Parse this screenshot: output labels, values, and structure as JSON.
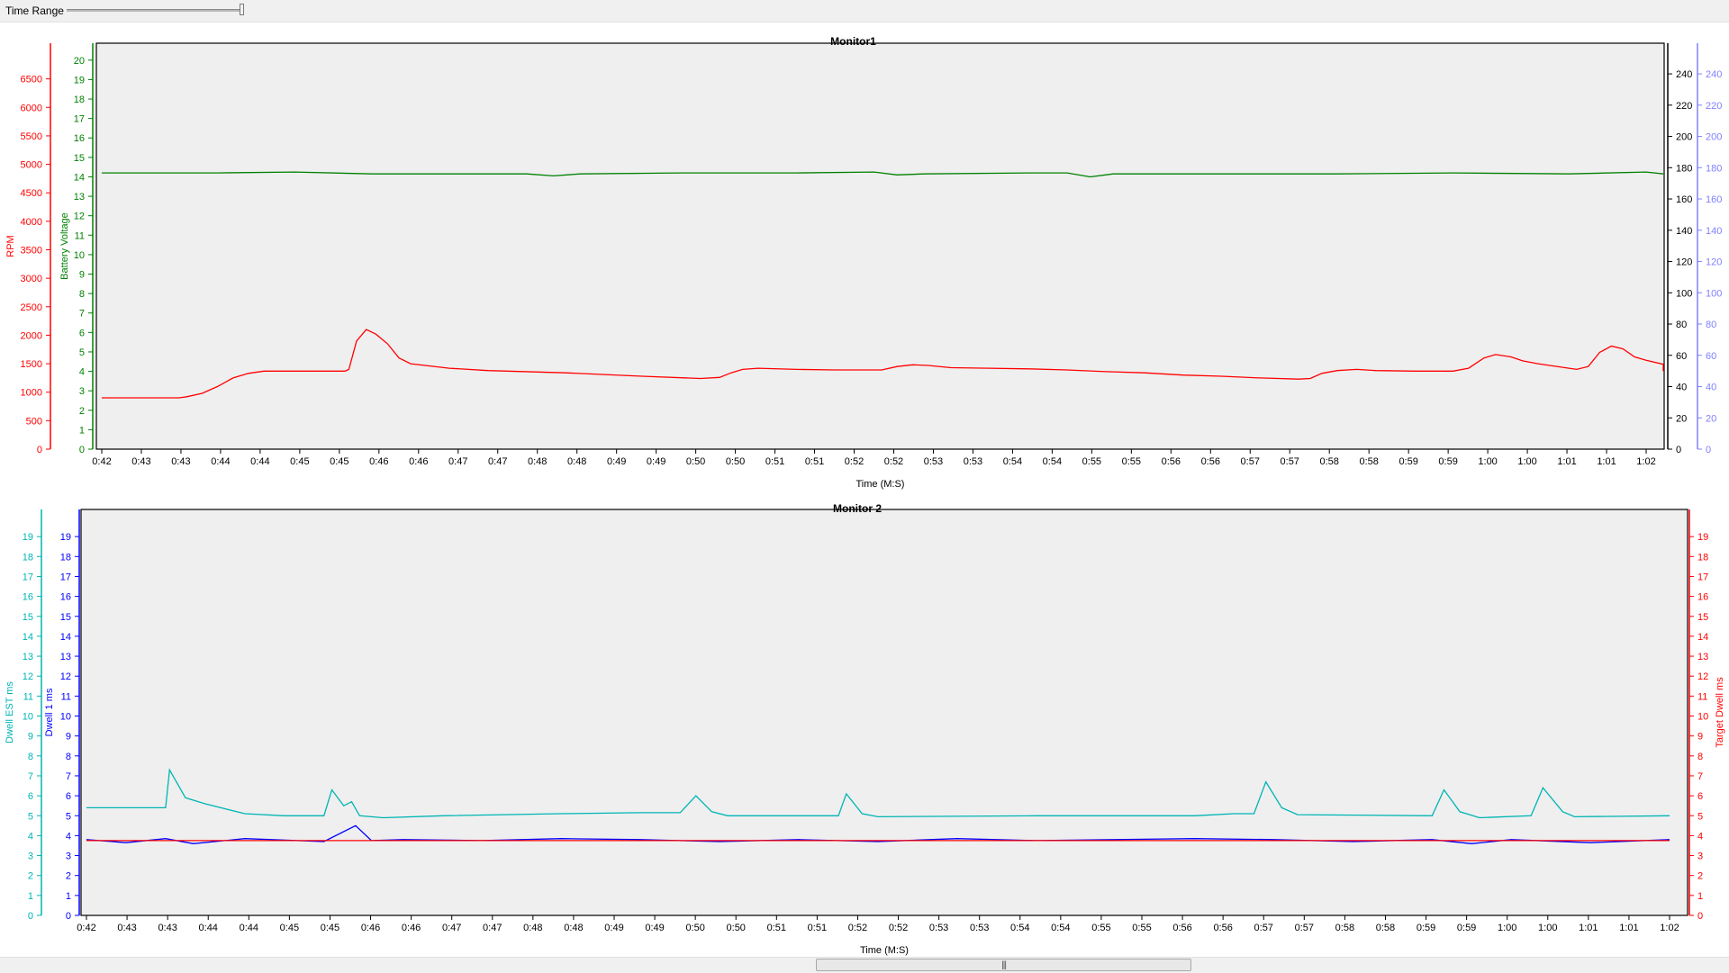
{
  "toolbar": {
    "time_range_label": "Time Range",
    "slider_value": 1.0
  },
  "scrollbar": {
    "thumb_start": 0.472,
    "thumb_end": 0.689
  },
  "colors": {
    "plot_background": "#efefef",
    "red": "#ff0000",
    "green": "#008000",
    "cyan": "#00b4b4",
    "blue": "#0000ff",
    "light_blue": "#8080ff"
  },
  "chart_data": [
    {
      "type": "line",
      "title": "Monitor1",
      "xlabel": "Time (M:S)",
      "x_tick_labels": [
        "0:42",
        "0:43",
        "0:43",
        "0:44",
        "0:44",
        "0:45",
        "0:45",
        "0:46",
        "0:46",
        "0:47",
        "0:47",
        "0:48",
        "0:48",
        "0:49",
        "0:49",
        "0:50",
        "0:50",
        "0:51",
        "0:51",
        "0:52",
        "0:52",
        "0:53",
        "0:53",
        "0:54",
        "0:54",
        "0:55",
        "0:55",
        "0:56",
        "0:56",
        "0:57",
        "0:57",
        "0:58",
        "0:58",
        "0:59",
        "0:59",
        "1:00",
        "1:00",
        "1:01",
        "1:01",
        "1:02"
      ],
      "x_range": [
        0,
        40
      ],
      "grid": false,
      "axes": [
        {
          "id": "rpm",
          "side": "left",
          "label": "RPM",
          "color": "#ff0000",
          "range": [
            0,
            7000
          ],
          "ticks": [
            0,
            500,
            1000,
            1500,
            2000,
            2500,
            3000,
            3500,
            4000,
            4500,
            5000,
            5500,
            6000,
            6500
          ]
        },
        {
          "id": "volt",
          "side": "left",
          "label": "Battery Voltage",
          "color": "#008000",
          "range": [
            0,
            20.5
          ],
          "ticks": [
            0,
            1,
            2,
            3,
            4,
            5,
            6,
            7,
            8,
            9,
            10,
            11,
            12,
            13,
            14,
            15,
            16,
            17,
            18,
            19,
            20
          ]
        },
        {
          "id": "r1",
          "side": "right",
          "label": "",
          "color": "#000000",
          "range": [
            0,
            255
          ],
          "ticks": [
            0,
            20,
            40,
            60,
            80,
            100,
            120,
            140,
            160,
            180,
            200,
            220,
            240
          ]
        },
        {
          "id": "r2",
          "side": "right",
          "label": "",
          "color": "#8080ff",
          "range": [
            0,
            255
          ],
          "ticks": [
            0,
            20,
            40,
            60,
            80,
            100,
            120,
            140,
            160,
            180,
            200,
            220,
            240
          ]
        }
      ],
      "series": [
        {
          "name": "RPM",
          "axis": "rpm",
          "color": "#ff0000",
          "points": [
            [
              0,
              900
            ],
            [
              2,
              900
            ],
            [
              2.2,
              920
            ],
            [
              2.6,
              980
            ],
            [
              3,
              1100
            ],
            [
              3.4,
              1250
            ],
            [
              3.8,
              1330
            ],
            [
              4.2,
              1370
            ],
            [
              6.3,
              1370
            ],
            [
              6.4,
              1400
            ],
            [
              6.6,
              1900
            ],
            [
              6.85,
              2100
            ],
            [
              7.1,
              2020
            ],
            [
              7.4,
              1850
            ],
            [
              7.7,
              1600
            ],
            [
              8,
              1500
            ],
            [
              9,
              1420
            ],
            [
              10,
              1380
            ],
            [
              12,
              1340
            ],
            [
              14,
              1280
            ],
            [
              15.5,
              1240
            ],
            [
              16,
              1260
            ],
            [
              16.3,
              1340
            ],
            [
              16.6,
              1400
            ],
            [
              17,
              1420
            ],
            [
              18,
              1400
            ],
            [
              19,
              1390
            ],
            [
              20.2,
              1390
            ],
            [
              20.6,
              1450
            ],
            [
              21,
              1480
            ],
            [
              21.4,
              1470
            ],
            [
              22,
              1430
            ],
            [
              23,
              1420
            ],
            [
              24,
              1410
            ],
            [
              25,
              1390
            ],
            [
              26,
              1360
            ],
            [
              27,
              1340
            ],
            [
              28,
              1300
            ],
            [
              29,
              1280
            ],
            [
              30,
              1250
            ],
            [
              31,
              1230
            ],
            [
              31.3,
              1240
            ],
            [
              31.6,
              1330
            ],
            [
              32,
              1380
            ],
            [
              32.5,
              1400
            ],
            [
              33,
              1380
            ],
            [
              34,
              1370
            ],
            [
              35,
              1370
            ],
            [
              35.4,
              1420
            ],
            [
              35.8,
              1600
            ],
            [
              36.1,
              1660
            ],
            [
              36.5,
              1620
            ],
            [
              36.8,
              1550
            ],
            [
              37.2,
              1500
            ],
            [
              37.6,
              1460
            ],
            [
              38,
              1420
            ],
            [
              38.2,
              1400
            ],
            [
              38.5,
              1450
            ],
            [
              38.8,
              1700
            ],
            [
              39.1,
              1810
            ],
            [
              39.4,
              1760
            ],
            [
              39.7,
              1620
            ],
            [
              40,
              1560
            ],
            [
              41,
              1490
            ],
            [
              42,
              1450
            ],
            [
              43,
              1420
            ],
            [
              44,
              1400
            ],
            [
              45,
              1370
            ]
          ]
        },
        {
          "name": "Battery Voltage",
          "axis": "volt",
          "color": "#008000",
          "points": [
            [
              0,
              14.2
            ],
            [
              3,
              14.2
            ],
            [
              5,
              14.25
            ],
            [
              7,
              14.15
            ],
            [
              9,
              14.15
            ],
            [
              11,
              14.15
            ],
            [
              11.7,
              14.05
            ],
            [
              12.4,
              14.15
            ],
            [
              15,
              14.2
            ],
            [
              18,
              14.2
            ],
            [
              20,
              14.25
            ],
            [
              20.6,
              14.1
            ],
            [
              21.3,
              14.15
            ],
            [
              24,
              14.2
            ],
            [
              25,
              14.2
            ],
            [
              25.6,
              14.0
            ],
            [
              26.2,
              14.15
            ],
            [
              28,
              14.15
            ],
            [
              30,
              14.15
            ],
            [
              32,
              14.15
            ],
            [
              35,
              14.2
            ],
            [
              38,
              14.15
            ],
            [
              40,
              14.25
            ],
            [
              41,
              14.15
            ],
            [
              43,
              14.15
            ],
            [
              45,
              14.15
            ]
          ]
        }
      ]
    },
    {
      "type": "line",
      "title": "Monitor 2",
      "xlabel": "Time (M:S)",
      "x_tick_labels": [
        "0:42",
        "0:43",
        "0:43",
        "0:44",
        "0:44",
        "0:45",
        "0:45",
        "0:46",
        "0:46",
        "0:47",
        "0:47",
        "0:48",
        "0:48",
        "0:49",
        "0:49",
        "0:50",
        "0:50",
        "0:51",
        "0:51",
        "0:52",
        "0:52",
        "0:53",
        "0:53",
        "0:54",
        "0:54",
        "0:55",
        "0:55",
        "0:56",
        "0:56",
        "0:57",
        "0:57",
        "0:58",
        "0:58",
        "0:59",
        "0:59",
        "1:00",
        "1:00",
        "1:01",
        "1:01",
        "1:02"
      ],
      "x_range": [
        0,
        40
      ],
      "grid": false,
      "axes": [
        {
          "id": "est",
          "side": "left",
          "label": "Dwell EST ms",
          "color": "#00b4b4",
          "range": [
            0,
            20
          ],
          "ticks": [
            0,
            1,
            2,
            3,
            4,
            5,
            6,
            7,
            8,
            9,
            10,
            11,
            12,
            13,
            14,
            15,
            16,
            17,
            18,
            19
          ]
        },
        {
          "id": "d1",
          "side": "left",
          "label": "Dwell 1 ms",
          "color": "#0000ff",
          "range": [
            0,
            20
          ],
          "ticks": [
            0,
            1,
            2,
            3,
            4,
            5,
            6,
            7,
            8,
            9,
            10,
            11,
            12,
            13,
            14,
            15,
            16,
            17,
            18,
            19
          ]
        },
        {
          "id": "tgt",
          "side": "right",
          "label": "Target Dwell ms",
          "color": "#ff0000",
          "range": [
            0,
            20
          ],
          "ticks": [
            0,
            1,
            2,
            3,
            4,
            5,
            6,
            7,
            8,
            9,
            10,
            11,
            12,
            13,
            14,
            15,
            16,
            17,
            18,
            19
          ]
        }
      ],
      "series": [
        {
          "name": "Dwell EST ms",
          "axis": "est",
          "color": "#00b4b4",
          "points": [
            [
              0,
              5.4
            ],
            [
              2,
              5.4
            ],
            [
              2.1,
              7.3
            ],
            [
              2.5,
              5.9
            ],
            [
              3,
              5.6
            ],
            [
              4,
              5.1
            ],
            [
              5,
              5.0
            ],
            [
              6,
              5.0
            ],
            [
              6.2,
              6.3
            ],
            [
              6.5,
              5.5
            ],
            [
              6.7,
              5.7
            ],
            [
              6.9,
              5.0
            ],
            [
              7.5,
              4.9
            ],
            [
              9,
              5.0
            ],
            [
              12,
              5.1
            ],
            [
              14,
              5.15
            ],
            [
              15,
              5.15
            ],
            [
              15.4,
              6.0
            ],
            [
              15.8,
              5.2
            ],
            [
              16.2,
              5.0
            ],
            [
              19,
              5.0
            ],
            [
              19.2,
              6.1
            ],
            [
              19.6,
              5.1
            ],
            [
              20,
              4.95
            ],
            [
              24,
              5.0
            ],
            [
              28,
              5.0
            ],
            [
              29,
              5.1
            ],
            [
              29.5,
              5.1
            ],
            [
              29.8,
              6.7
            ],
            [
              30.2,
              5.4
            ],
            [
              30.6,
              5.05
            ],
            [
              34,
              5.0
            ],
            [
              34.3,
              6.3
            ],
            [
              34.7,
              5.2
            ],
            [
              35.2,
              4.9
            ],
            [
              36.5,
              5.0
            ],
            [
              36.8,
              6.4
            ],
            [
              37.3,
              5.2
            ],
            [
              37.6,
              4.95
            ],
            [
              40,
              5.0
            ]
          ]
        },
        {
          "name": "Dwell 1 ms",
          "axis": "d1",
          "color": "#0000ff",
          "points": [
            [
              0,
              3.8
            ],
            [
              1,
              3.65
            ],
            [
              2,
              3.85
            ],
            [
              2.7,
              3.6
            ],
            [
              3.5,
              3.75
            ],
            [
              4,
              3.85
            ],
            [
              6,
              3.7
            ],
            [
              6.8,
              4.5
            ],
            [
              7.2,
              3.75
            ],
            [
              8,
              3.8
            ],
            [
              10,
              3.75
            ],
            [
              12,
              3.85
            ],
            [
              14,
              3.8
            ],
            [
              16,
              3.7
            ],
            [
              18,
              3.8
            ],
            [
              20,
              3.7
            ],
            [
              22,
              3.85
            ],
            [
              24,
              3.75
            ],
            [
              26,
              3.8
            ],
            [
              28,
              3.85
            ],
            [
              30,
              3.8
            ],
            [
              32,
              3.7
            ],
            [
              34,
              3.8
            ],
            [
              35,
              3.6
            ],
            [
              36,
              3.8
            ],
            [
              38,
              3.65
            ],
            [
              40,
              3.8
            ]
          ]
        },
        {
          "name": "Target Dwell ms",
          "axis": "tgt",
          "color": "#ff0000",
          "points": [
            [
              0,
              3.75
            ],
            [
              40,
              3.75
            ]
          ]
        }
      ]
    }
  ]
}
